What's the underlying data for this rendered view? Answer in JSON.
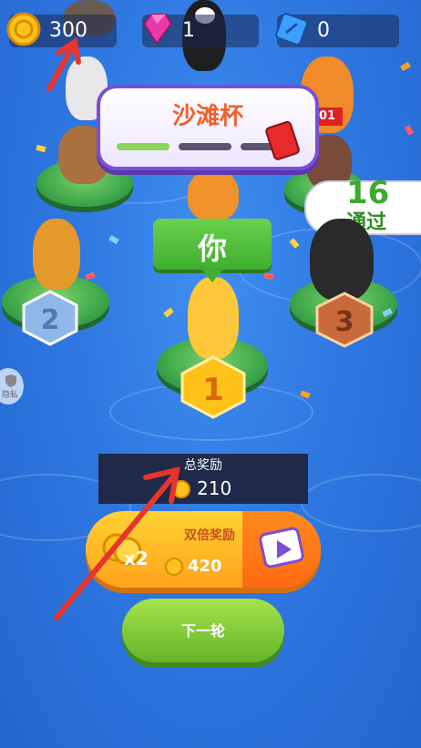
{
  "hud": {
    "coins": "300",
    "gems": "1",
    "tickets": "0"
  },
  "trophy": {
    "title": "沙滩杯",
    "progress": [
      1,
      0,
      0
    ]
  },
  "pass_status": {
    "count": "16",
    "label": "通过"
  },
  "you_label": "你",
  "podium": {
    "first": "1",
    "second": "2",
    "third": "3"
  },
  "privacy_label": "隐私",
  "reward": {
    "title": "总奖励",
    "amount": "210"
  },
  "double_button": {
    "label": "双倍奖励",
    "multiplier": "x2",
    "amount": "420"
  },
  "next_button": {
    "label": "下一轮"
  },
  "colors": {
    "gold": "#ffc21a",
    "silver": "#8fb8e8",
    "bronze": "#c96a3a",
    "pad_green": "#3fa84b"
  }
}
